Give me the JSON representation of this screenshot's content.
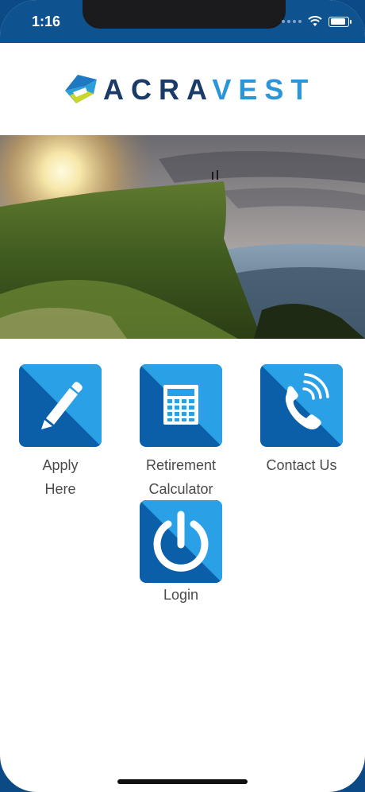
{
  "status": {
    "time": "1:16"
  },
  "brand": {
    "name_part1": "ACRA",
    "name_part2": "VEST"
  },
  "menu": [
    {
      "id": "apply",
      "label_line1": "Apply",
      "label_line2": "Here",
      "icon": "pencil-icon"
    },
    {
      "id": "retirement",
      "label_line1": "Retirement",
      "label_line2": "Calculator",
      "icon": "calculator-icon"
    },
    {
      "id": "contact",
      "label_line1": "Contact Us",
      "label_line2": "",
      "icon": "phone-icon"
    },
    {
      "id": "login",
      "label_line1": "Login",
      "label_line2": "",
      "icon": "power-icon"
    }
  ],
  "colors": {
    "tile_light": "#2aa0e6",
    "tile_dark": "#0b5fa8",
    "header": "#0f5290"
  }
}
